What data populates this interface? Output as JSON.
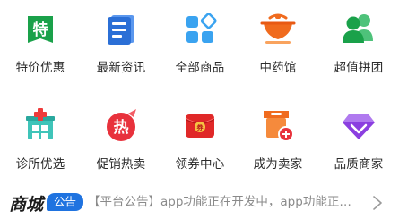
{
  "menu": [
    {
      "label": "特价优惠",
      "icon": "special-offer-icon"
    },
    {
      "label": "最新资讯",
      "icon": "news-icon"
    },
    {
      "label": "全部商品",
      "icon": "all-products-icon"
    },
    {
      "label": "中药馆",
      "icon": "herbal-pot-icon"
    },
    {
      "label": "超值拼团",
      "icon": "group-buy-icon"
    },
    {
      "label": "诊所优选",
      "icon": "clinic-icon"
    },
    {
      "label": "促销热卖",
      "icon": "hot-sale-icon"
    },
    {
      "label": "领券中心",
      "icon": "coupon-icon"
    },
    {
      "label": "成为卖家",
      "icon": "become-seller-icon"
    },
    {
      "label": "品质商家",
      "icon": "quality-merchant-icon"
    }
  ],
  "notice": {
    "logo": "商城",
    "badge": "公告",
    "text": "【平台公告】app功能正在开发中，app功能正…",
    "more_icon": "chevron-right-icon"
  },
  "colors": {
    "badge": "#1f73e0",
    "green": "#1aa14a",
    "blue": "#2b6fd6",
    "orange": "#f06b1e",
    "red": "#e8323c",
    "purple": "#8b3fe0"
  }
}
